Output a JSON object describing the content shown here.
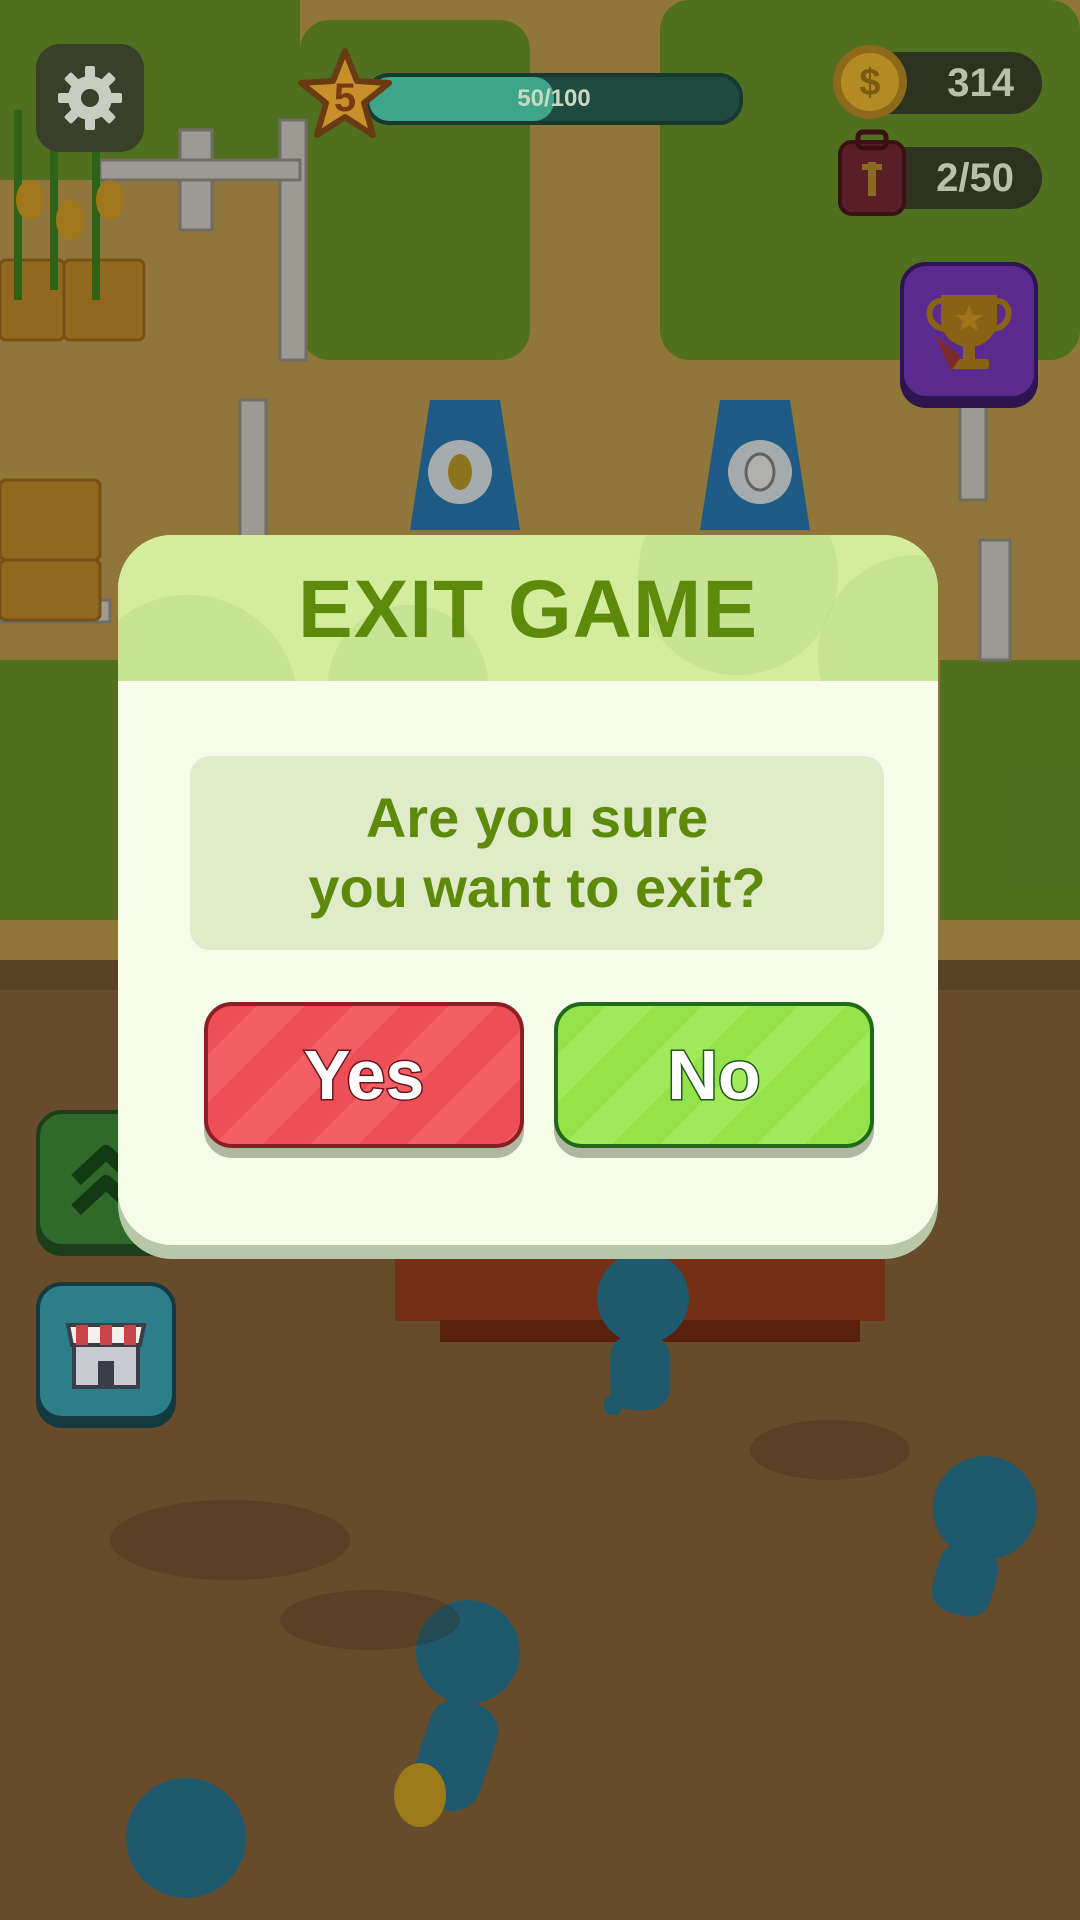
{
  "hud": {
    "level": "5",
    "xp_text": "50/100",
    "xp_progress": 0.5,
    "coins": "314",
    "bag_capacity": "2/50"
  },
  "dialog": {
    "title": "EXIT GAME",
    "message_line1": "Are you sure",
    "message_line2": "you want to exit?",
    "yes_label": "Yes",
    "no_label": "No"
  },
  "icons": {
    "settings": "gear-icon",
    "coin": "coin-icon",
    "bag": "backpack-icon",
    "trophy": "trophy-icon",
    "upgrade": "chevrons-up-icon",
    "shop": "shop-icon"
  },
  "colors": {
    "title_green": "#5e8a0c",
    "yes_red": "#ee4e55",
    "no_green": "#94e34b",
    "trophy_purple": "#5b2a8f"
  }
}
